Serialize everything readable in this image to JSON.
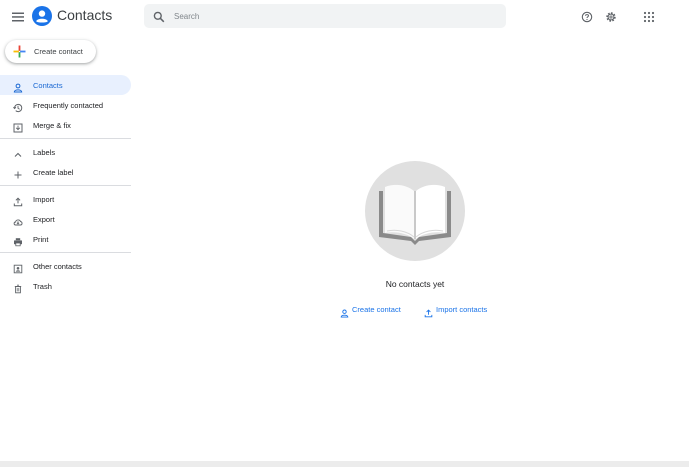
{
  "header": {
    "title": "Contacts",
    "search_placeholder": "Search"
  },
  "create_button": {
    "label": "Create contact"
  },
  "sidebar": {
    "items": [
      {
        "label": "Contacts",
        "icon": "person-icon",
        "active": true
      },
      {
        "label": "Frequently contacted",
        "icon": "history-icon"
      },
      {
        "label": "Merge & fix",
        "icon": "merge-icon"
      }
    ],
    "labels_section": [
      {
        "label": "Labels",
        "icon": "chevron-up-icon"
      },
      {
        "label": "Create label",
        "icon": "plus-icon"
      }
    ],
    "io_section": [
      {
        "label": "Import",
        "icon": "upload-icon"
      },
      {
        "label": "Export",
        "icon": "cloud-download-icon"
      },
      {
        "label": "Print",
        "icon": "printer-icon"
      }
    ],
    "other_section": [
      {
        "label": "Other contacts",
        "icon": "other-contacts-icon"
      },
      {
        "label": "Trash",
        "icon": "trash-icon"
      }
    ]
  },
  "empty_state": {
    "message": "No contacts yet",
    "create_label": "Create contact",
    "import_label": "Import contacts"
  },
  "colors": {
    "accent": "#1a73e8",
    "active_bg": "#e8f0fe",
    "search_bg": "#f1f3f4",
    "circle_bg": "#e0e0e0"
  }
}
